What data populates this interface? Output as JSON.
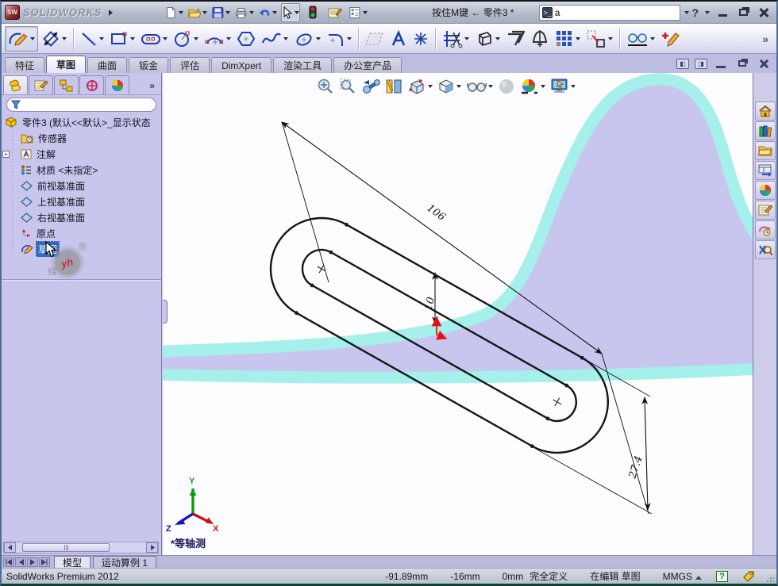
{
  "window": {
    "logo_text": "SOLIDWORKS",
    "title": "按住M键 ← 零件3 *",
    "search": {
      "value": "a"
    },
    "help_glyph": "?"
  },
  "toolbar_main": {
    "icons": [
      "new-document",
      "open",
      "save",
      "print",
      "undo",
      "select",
      "rebuild-traffic-light",
      "options",
      "design-checker"
    ]
  },
  "toolbar_sketch": {
    "icons": [
      "sketch",
      "smart-dimension",
      "line",
      "corner-rectangle",
      "straight-slot",
      "circle",
      "centerpoint-arc",
      "polygon",
      "spline",
      "ellipse",
      "sketch-fillet",
      "plane",
      "text",
      "point",
      "trim-entities",
      "convert-entities",
      "offset-entities",
      "mirror-entities",
      "linear-sketch-pattern",
      "move-entities",
      "display-delete-relations",
      "repair-sketch"
    ],
    "overflow_chevron": "»"
  },
  "cmd_tabs": {
    "items": [
      {
        "label": "特征"
      },
      {
        "label": "草图"
      },
      {
        "label": "曲面"
      },
      {
        "label": "钣金"
      },
      {
        "label": "评估"
      },
      {
        "label": "DimXpert"
      },
      {
        "label": "渲染工具"
      },
      {
        "label": "办公室产品"
      }
    ]
  },
  "panel_tabs": {
    "icons": [
      "featuremanager-tree",
      "propertymanager",
      "configurationmanager",
      "dimxpertmanager",
      "displaymanager"
    ],
    "overflow_chevron": "»"
  },
  "tree": {
    "root": "零件3 (默认<<默认>_显示状态",
    "items": [
      {
        "label": "传感器",
        "icon": "sensors-folder"
      },
      {
        "label": "注解",
        "icon": "annotations",
        "expander": "+"
      },
      {
        "label": "材质 <未指定>",
        "icon": "material"
      },
      {
        "label": "前视基准面",
        "icon": "reference-plane"
      },
      {
        "label": "上视基准面",
        "icon": "reference-plane"
      },
      {
        "label": "右视基准面",
        "icon": "reference-plane"
      },
      {
        "label": "原点",
        "icon": "origin"
      },
      {
        "label": "草图",
        "icon": "sketch",
        "selected": true
      }
    ]
  },
  "watermark": {
    "badge": "yh",
    "char_top": "余",
    "char_left": "辉"
  },
  "heads_up": {
    "icons": [
      "zoom-to-fit",
      "zoom-to-area",
      "previous-view",
      "section-view",
      "view-orientation",
      "display-style",
      "hide-show-items",
      "edit-appearance",
      "apply-scene",
      "view-settings"
    ]
  },
  "task_pane": {
    "icons": [
      "home",
      "design-library",
      "file-explorer",
      "view-palette",
      "appearances",
      "custom-properties",
      "drive-works-xpress",
      "sw-search"
    ]
  },
  "viewport": {
    "dimensions": {
      "length": "106",
      "width": "27.4",
      "inner_width": "10"
    },
    "view_label": "*等轴测",
    "triad": {
      "x": "X",
      "y": "Y",
      "z": "Z"
    }
  },
  "model_tabs": {
    "items": [
      {
        "label": "模型"
      },
      {
        "label": "运动算例 1"
      }
    ]
  },
  "status_bar": {
    "product": "SolidWorks Premium 2012",
    "coord_x": "-91.89mm",
    "coord_y": "-16mm",
    "coord_z": "0mm",
    "definition_state": "完全定义",
    "editing_state": "在编辑 草图",
    "units": "MMGS"
  },
  "colors": {
    "selection": "#316ac5",
    "panel": "#c9c6ee",
    "background_blob": "#c8c5ee",
    "background_outline": "#a5f0ea",
    "origin_red": "#e81010",
    "axis_x": "#cc1111",
    "axis_y": "#119911",
    "axis_z": "#1111cc"
  }
}
